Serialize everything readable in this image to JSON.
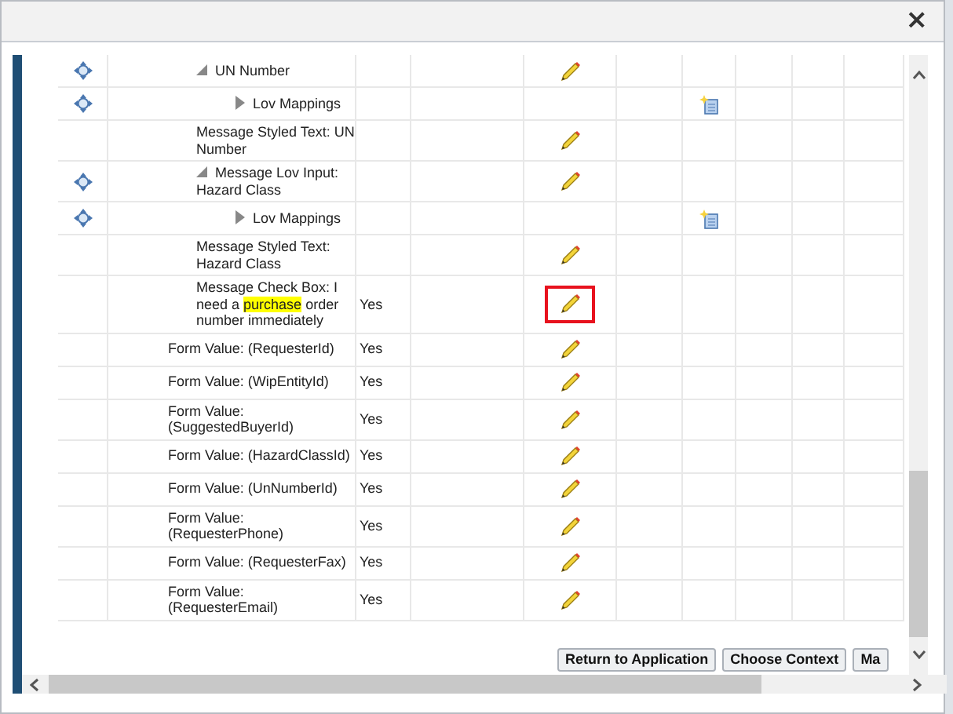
{
  "dialog": {
    "close": "×"
  },
  "rows": [
    {
      "kind": "node",
      "name": "UN Number",
      "expanded": true,
      "move_icon": true,
      "edit_icon": true,
      "create_icon": false,
      "flagged": false,
      "children": [
        {
          "kind": "node",
          "name": "Lov Mappings",
          "expanded": false,
          "move_icon": true,
          "edit_icon": false,
          "create_icon": true,
          "flagged": false
        }
      ]
    },
    {
      "kind": "node",
      "name": "Message Styled Text: UN Number",
      "move_icon": false,
      "edit_icon": true,
      "create_icon": false,
      "flagged": false
    },
    {
      "kind": "node",
      "name": "Message Lov Input: Hazard Class",
      "expanded": true,
      "move_icon": true,
      "edit_icon": true,
      "create_icon": false,
      "flagged": false,
      "children": [
        {
          "kind": "node",
          "name": "Lov Mappings",
          "expanded": false,
          "move_icon": true,
          "edit_icon": false,
          "create_icon": true,
          "flagged": false
        }
      ]
    },
    {
      "kind": "node",
      "name": "Message Styled Text: Hazard Class",
      "move_icon": false,
      "edit_icon": true,
      "create_icon": false,
      "flagged": false
    },
    {
      "kind": "node",
      "name": [
        {
          "text": "Message Check Box: I need a ",
          "highlighted": false
        },
        {
          "text": "purchase",
          "highlighted": true
        },
        {
          "text": " order number immediately",
          "highlighted": false
        }
      ],
      "value": "Yes",
      "move_icon": false,
      "edit_icon": true,
      "create_icon": false,
      "flagged": true
    },
    {
      "kind": "form_value",
      "name": "Form Value: (RequesterId)",
      "value": "Yes",
      "move_icon": false,
      "edit_icon": true,
      "create_icon": false,
      "flagged": false
    },
    {
      "kind": "form_value",
      "name": "Form Value: (WipEntityId)",
      "value": "Yes",
      "move_icon": false,
      "edit_icon": true,
      "create_icon": false,
      "flagged": false
    },
    {
      "kind": "form_value",
      "name": "Form Value: (SuggestedBuyerId)",
      "value": "Yes",
      "move_icon": false,
      "edit_icon": true,
      "create_icon": false,
      "flagged": false
    },
    {
      "kind": "form_value",
      "name": "Form Value: (HazardClassId)",
      "value": "Yes",
      "move_icon": false,
      "edit_icon": true,
      "create_icon": false,
      "flagged": false
    },
    {
      "kind": "form_value",
      "name": "Form Value: (UnNumberId)",
      "value": "Yes",
      "move_icon": false,
      "edit_icon": true,
      "create_icon": false,
      "flagged": false
    },
    {
      "kind": "form_value",
      "name": "Form Value: (RequesterPhone)",
      "value": "Yes",
      "move_icon": false,
      "edit_icon": true,
      "create_icon": false,
      "flagged": false
    },
    {
      "kind": "form_value",
      "name": "Form Value: (RequesterFax)",
      "value": "Yes",
      "move_icon": false,
      "edit_icon": true,
      "create_icon": false,
      "flagged": false
    },
    {
      "kind": "form_value",
      "name": "Form Value: (RequesterEmail)",
      "value": "Yes",
      "move_icon": false,
      "edit_icon": true,
      "create_icon": false,
      "flagged": false
    }
  ],
  "buttons": [
    "Return to Application",
    "Choose Context",
    "Ma"
  ]
}
